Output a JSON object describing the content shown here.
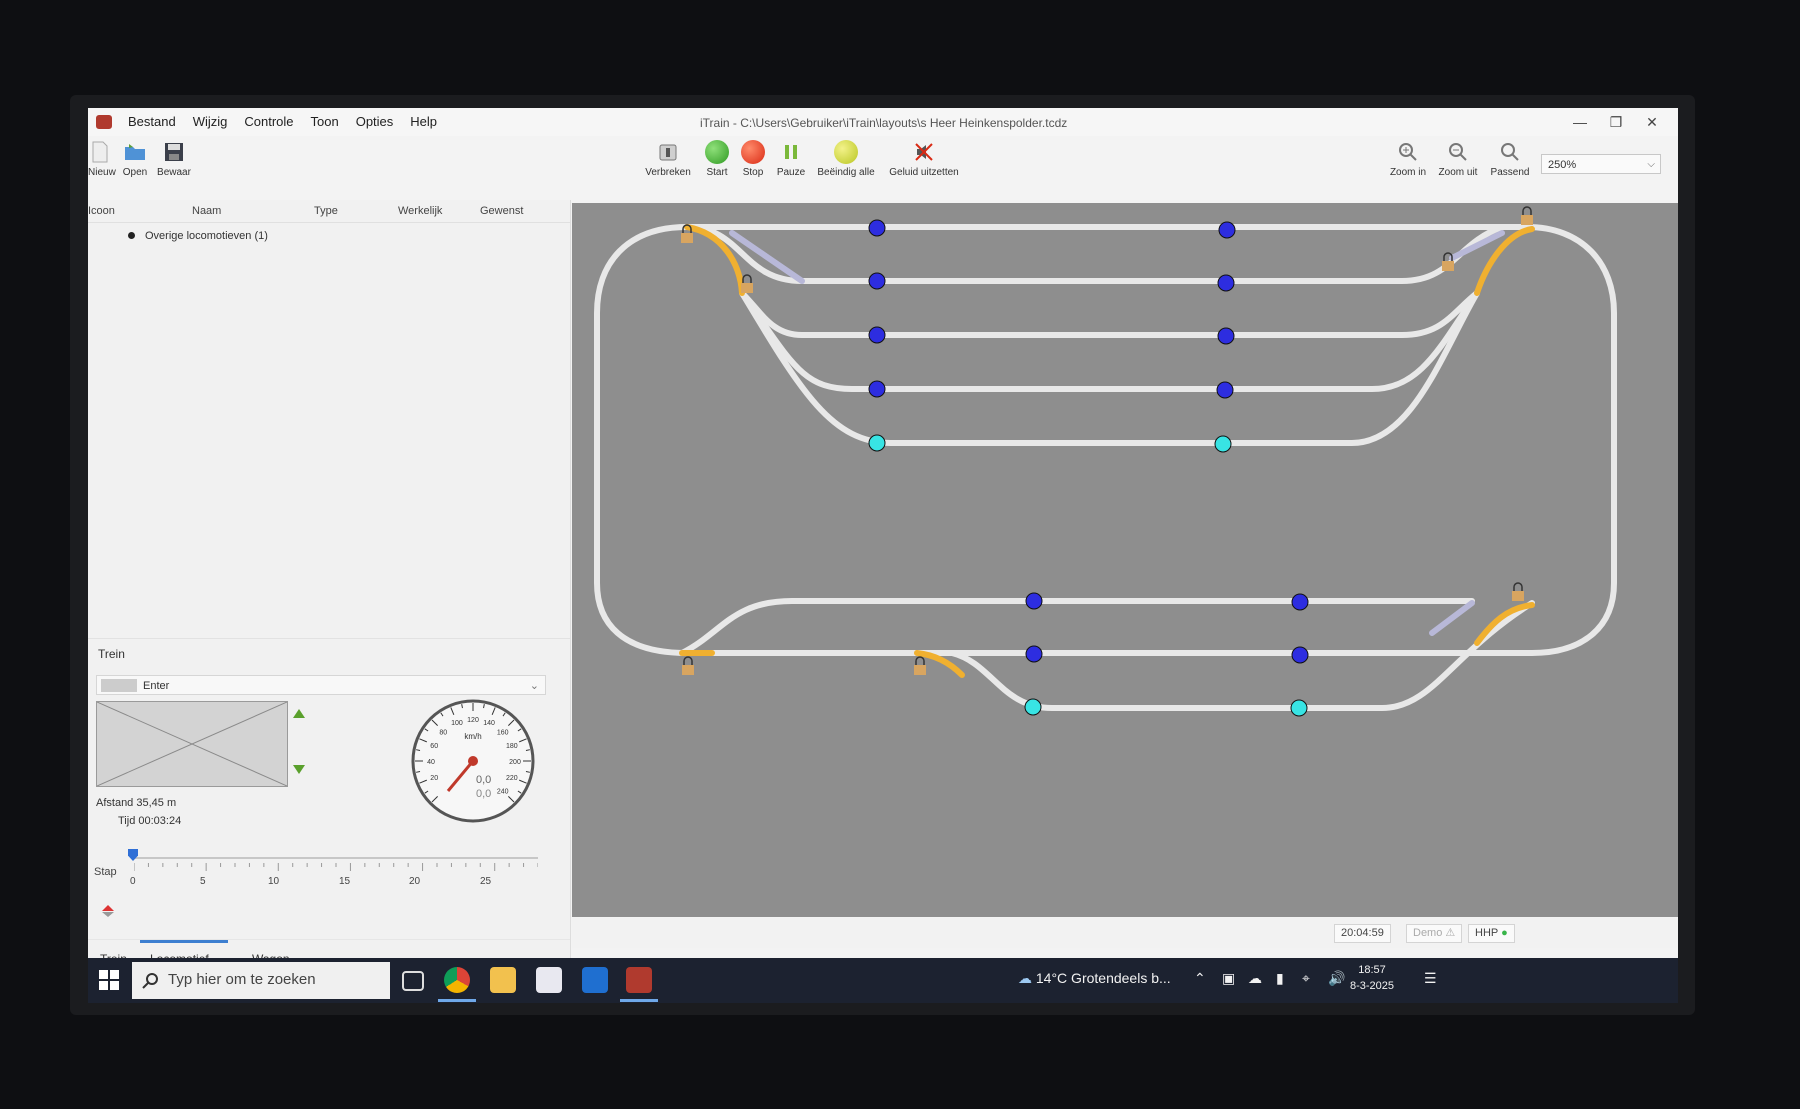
{
  "window": {
    "title": "iTrain - C:\\Users\\Gebruiker\\iTrain\\layouts\\s Heer Heinkenspolder.tcdz",
    "menu": [
      "Bestand",
      "Wijzig",
      "Controle",
      "Toon",
      "Opties",
      "Help"
    ]
  },
  "toolbar": {
    "new": "Nieuw",
    "open": "Open",
    "save": "Bewaar",
    "disconnect": "Verbreken",
    "start": "Start",
    "stop": "Stop",
    "pause": "Pauze",
    "end_all": "Beëindig alle",
    "mute": "Geluid uitzetten",
    "zoom_in": "Zoom in",
    "zoom_out": "Zoom uit",
    "fit": "Passend",
    "zoom_level": "250%"
  },
  "loco_table": {
    "columns": [
      "Icoon",
      "Naam",
      "Type",
      "Werkelijk",
      "Gewenst"
    ],
    "rows": [
      "Overige locomotieven (1)"
    ]
  },
  "train_panel": {
    "title": "Trein",
    "selected": "Enter",
    "distance_label": "Afstand",
    "distance": "35,45 m",
    "time_label": "Tijd",
    "time": "00:03:24",
    "speed_unit": "km/h",
    "speed_actual": "0,0",
    "speed_target": "0,0",
    "speed_ticks": [
      "20",
      "40",
      "60",
      "80",
      "100",
      "120",
      "140",
      "160",
      "180",
      "200",
      "220",
      "240"
    ],
    "step_label": "Stap",
    "step_ticks": [
      "0",
      "5",
      "10",
      "15",
      "20",
      "25"
    ],
    "step_value": 0,
    "tabs": [
      "Trein",
      "Locomotief",
      "Wagon"
    ]
  },
  "status_bar": {
    "clock": "20:04:59",
    "mode": "Demo",
    "hhp": "HHP"
  },
  "taskbar": {
    "search_placeholder": "Typ hier om te zoeken",
    "weather": "14°C Grotendeels b...",
    "time": "18:57",
    "date": "8-3-2025"
  },
  "colors": {
    "track": "#e8e8e8",
    "track_reserved": "#f0b030",
    "track_switch": "#b8b8d8",
    "sensor_off": "#2d2de0",
    "sensor_on": "#38e4e4",
    "canvas_bg": "#8e8e8e"
  }
}
